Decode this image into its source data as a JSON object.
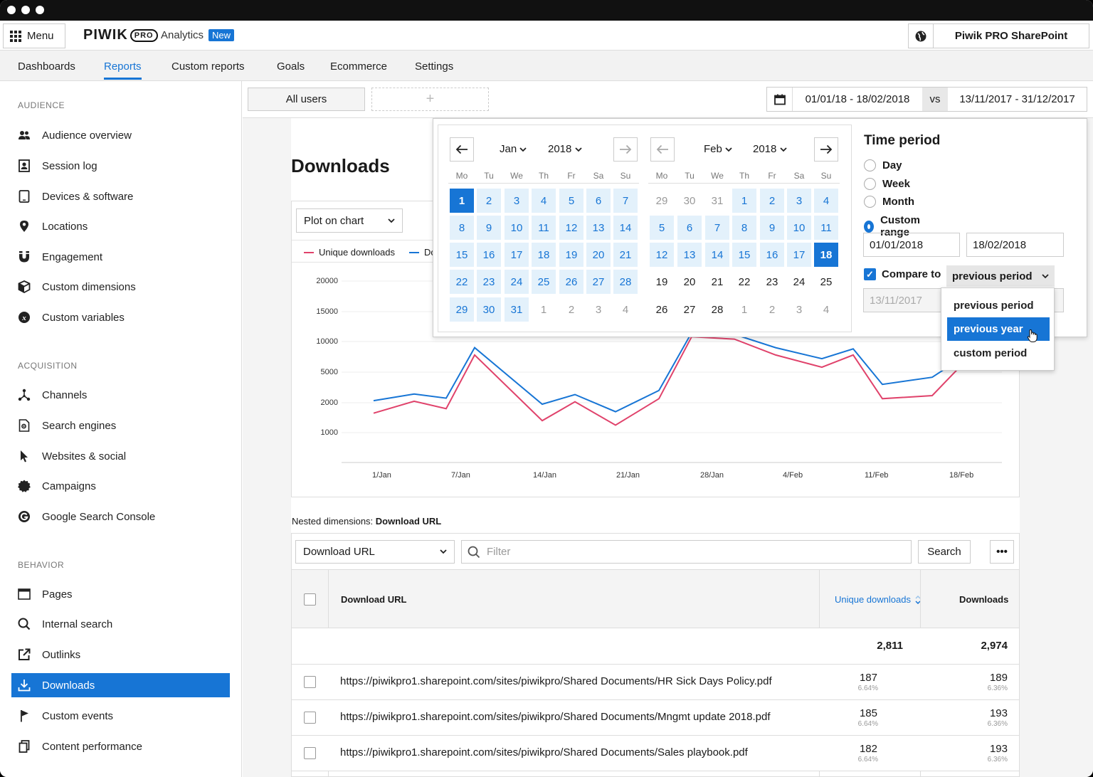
{
  "topbar": {
    "menu_label": "Menu",
    "logo_text": "PIWIK",
    "logo_pro": "PRO",
    "product": "Analytics",
    "new_badge": "New",
    "site_name": "Piwik PRO SharePoint"
  },
  "nav": {
    "tabs": [
      "Dashboards",
      "Reports",
      "Custom reports",
      "Goals",
      "Ecommerce",
      "Settings"
    ],
    "active": "Reports"
  },
  "sidebar": {
    "sections": [
      {
        "label": "AUDIENCE",
        "items": [
          {
            "label": "Audience overview",
            "icon": "people-icon"
          },
          {
            "label": "Session log",
            "icon": "user-card-icon"
          },
          {
            "label": "Devices & software",
            "icon": "tablet-icon"
          },
          {
            "label": "Locations",
            "icon": "map-pin-icon"
          },
          {
            "label": "Engagement",
            "icon": "magnet-icon"
          },
          {
            "label": "Custom dimensions",
            "icon": "cube-icon"
          },
          {
            "label": "Custom variables",
            "icon": "variable-icon"
          }
        ]
      },
      {
        "label": "ACQUISITION",
        "items": [
          {
            "label": "Channels",
            "icon": "network-icon"
          },
          {
            "label": "Search engines",
            "icon": "search-doc-icon"
          },
          {
            "label": "Websites & social",
            "icon": "cursor-icon"
          },
          {
            "label": "Campaigns",
            "icon": "badge-icon"
          },
          {
            "label": "Google Search Console",
            "icon": "google-icon"
          }
        ]
      },
      {
        "label": "BEHAVIOR",
        "items": [
          {
            "label": "Pages",
            "icon": "browser-icon"
          },
          {
            "label": "Internal search",
            "icon": "search-icon"
          },
          {
            "label": "Outlinks",
            "icon": "external-link-icon"
          },
          {
            "label": "Downloads",
            "icon": "download-icon",
            "active": true
          },
          {
            "label": "Custom events",
            "icon": "flag-icon"
          },
          {
            "label": "Content performance",
            "icon": "copy-icon"
          }
        ]
      }
    ]
  },
  "segments": {
    "all_users": "All users",
    "add": "+"
  },
  "daterange": {
    "primary": "01/01/18 - 18/02/2018",
    "vs": "vs",
    "compare": "13/11/2017 - 31/12/2017"
  },
  "page": {
    "title": "Downloads"
  },
  "chart": {
    "plot_select": "Plot on chart",
    "legend": [
      "Unique downloads",
      "Do"
    ]
  },
  "chart_data": {
    "type": "line",
    "x": [
      "1/Jan",
      "7/Jan",
      "14/Jan",
      "21/Jan",
      "28/Jan",
      "4/Feb",
      "11/Feb",
      "18/Feb"
    ],
    "yticks": [
      "20000",
      "15000",
      "10000",
      "5000",
      "2000",
      "1000"
    ],
    "series": [
      {
        "name": "Unique downloads",
        "color": "#e0426b",
        "values": [
          1650,
          2150,
          1800,
          7800,
          1400,
          2100,
          1250,
          2400,
          10800,
          10400,
          7800,
          5800,
          7800,
          2400,
          2700,
          6000
        ]
      },
      {
        "name": "Do",
        "color": "#1775d5",
        "values": [
          2200,
          2850,
          2450,
          9000,
          1950,
          2800,
          1700,
          3200,
          11500,
          11200,
          9000,
          7200,
          8800,
          3800,
          4500,
          7200
        ]
      }
    ]
  },
  "table": {
    "nested_label": "Nested dimensions:",
    "nested_value": "Download URL",
    "dimension_select": "Download URL",
    "filter_placeholder": "Filter",
    "search_label": "Search",
    "more_label": "•••",
    "headers": {
      "url": "Download URL",
      "unique": "Unique downloads",
      "downloads": "Downloads"
    },
    "totals": {
      "unique": "2,811",
      "downloads": "2,974"
    },
    "rows": [
      {
        "url": "https://piwikpro1.sharepoint.com/sites/piwikpro/Shared Documents/HR Sick Days Policy.pdf",
        "unique": "187",
        "unique_pct": "6.64%",
        "downloads": "189",
        "downloads_pct": "6.36%"
      },
      {
        "url": "https://piwikpro1.sharepoint.com/sites/piwikpro/Shared Documents/Mngmt update 2018.pdf",
        "unique": "185",
        "unique_pct": "6.64%",
        "downloads": "193",
        "downloads_pct": "6.36%"
      },
      {
        "url": "https://piwikpro1.sharepoint.com/sites/piwikpro/Shared Documents/Sales playbook.pdf",
        "unique": "182",
        "unique_pct": "6.64%",
        "downloads": "193",
        "downloads_pct": "6.36%"
      }
    ]
  },
  "calendar": {
    "weekdays": [
      "Mo",
      "Tu",
      "We",
      "Th",
      "Fr",
      "Sa",
      "Su"
    ],
    "left": {
      "month": "Jan",
      "year": "2018",
      "weeks": [
        [
          [
            "1",
            "edge"
          ],
          [
            "2",
            "sel"
          ],
          [
            "3",
            "sel"
          ],
          [
            "4",
            "sel"
          ],
          [
            "5",
            "sel"
          ],
          [
            "6",
            "sel"
          ],
          [
            "7",
            "sel"
          ]
        ],
        [
          [
            "8",
            "sel"
          ],
          [
            "9",
            "sel"
          ],
          [
            "10",
            "sel"
          ],
          [
            "11",
            "sel"
          ],
          [
            "12",
            "sel"
          ],
          [
            "13",
            "sel"
          ],
          [
            "14",
            "sel"
          ]
        ],
        [
          [
            "15",
            "sel"
          ],
          [
            "16",
            "sel"
          ],
          [
            "17",
            "sel"
          ],
          [
            "18",
            "sel"
          ],
          [
            "19",
            "sel"
          ],
          [
            "20",
            "sel"
          ],
          [
            "21",
            "sel"
          ]
        ],
        [
          [
            "22",
            "sel"
          ],
          [
            "23",
            "sel"
          ],
          [
            "24",
            "sel"
          ],
          [
            "25",
            "sel"
          ],
          [
            "26",
            "sel"
          ],
          [
            "27",
            "sel"
          ],
          [
            "28",
            "sel"
          ]
        ],
        [
          [
            "29",
            "sel"
          ],
          [
            "30",
            "sel"
          ],
          [
            "31",
            "sel"
          ],
          [
            "1",
            "out"
          ],
          [
            "2",
            "out"
          ],
          [
            "3",
            "out"
          ],
          [
            "4",
            "out"
          ]
        ]
      ]
    },
    "right": {
      "month": "Feb",
      "year": "2018",
      "weeks": [
        [
          [
            "29",
            "out"
          ],
          [
            "30",
            "out"
          ],
          [
            "31",
            "out"
          ],
          [
            "1",
            "sel"
          ],
          [
            "2",
            "sel"
          ],
          [
            "3",
            "sel"
          ],
          [
            "4",
            "sel"
          ]
        ],
        [
          [
            "5",
            "sel"
          ],
          [
            "6",
            "sel"
          ],
          [
            "7",
            "sel"
          ],
          [
            "8",
            "sel"
          ],
          [
            "9",
            "sel"
          ],
          [
            "10",
            "sel"
          ],
          [
            "11",
            "sel"
          ]
        ],
        [
          [
            "12",
            "sel"
          ],
          [
            "13",
            "sel"
          ],
          [
            "14",
            "sel"
          ],
          [
            "15",
            "sel"
          ],
          [
            "16",
            "sel"
          ],
          [
            "17",
            "sel"
          ],
          [
            "18",
            "edge"
          ]
        ],
        [
          [
            "19",
            "norm"
          ],
          [
            "20",
            "norm"
          ],
          [
            "21",
            "norm"
          ],
          [
            "22",
            "norm"
          ],
          [
            "23",
            "norm"
          ],
          [
            "24",
            "norm"
          ],
          [
            "25",
            "norm"
          ]
        ],
        [
          [
            "26",
            "norm"
          ],
          [
            "27",
            "norm"
          ],
          [
            "28",
            "norm"
          ],
          [
            "1",
            "out"
          ],
          [
            "2",
            "out"
          ],
          [
            "3",
            "out"
          ],
          [
            "4",
            "out"
          ]
        ]
      ]
    }
  },
  "time_period": {
    "title": "Time period",
    "options": [
      "Day",
      "Week",
      "Month",
      "Custom range"
    ],
    "selected": "Custom range",
    "from": "01/01/2018",
    "to": "18/02/2018",
    "compare_label": "Compare to",
    "compare_value": "previous period",
    "compare_from": "13/11/2017",
    "dropdown": [
      "previous period",
      "previous year",
      "custom period"
    ],
    "highlighted": "previous year"
  }
}
